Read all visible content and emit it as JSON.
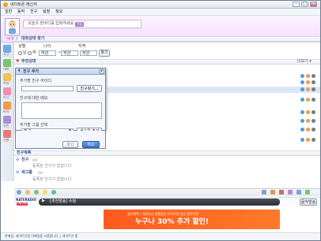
{
  "window": {
    "title": "네이트온 메신저",
    "min": "–",
    "max": "□",
    "close": "×"
  },
  "menu": [
    "일반",
    "동작",
    "친구",
    "설정",
    "정보"
  ],
  "profile": {
    "message": "오늘의 한마디를 입력하세요.",
    "edit_label": "편집",
    "avatar_caption": "내 정보"
  },
  "left_nav": [
    "친구",
    "대화",
    "쪽지",
    "미니",
    "싸이",
    "일촌",
    "선물"
  ],
  "search": {
    "header": "대화상대 찾기",
    "gender_label": "성별",
    "age_label": "나이",
    "region_label": "지역",
    "male_label": "남",
    "female_label": "여",
    "age_from": "무관",
    "age_to": "무관",
    "region_value": "무관",
    "search_button": "찾기"
  },
  "recommend": {
    "header": "추천상대",
    "more": "더보기 ▾"
  },
  "dialog": {
    "title": "친구 추가",
    "close": "×",
    "id_label": "추가할 친구 아이디",
    "find_button": "친구찾기...",
    "memo_label": "친구에 대한 메모",
    "group_label": "추가할 그룹 선택",
    "group_value": "친구",
    "add_group_button": "새그룹 추가",
    "ok_button": "확인",
    "cancel_button": "취소"
  },
  "friends": {
    "header": "친구목록",
    "groups": [
      {
        "name": "친구",
        "count": "0/0",
        "empty": "등록된 친구가 없습니다"
      },
      {
        "name": "새그룹",
        "count": "0/0",
        "empty": "등록된 친구가 없습니다"
      }
    ]
  },
  "radio": {
    "logo_top": "NATERADIO",
    "logo_bottom": "ON AIR",
    "now_playing": "[추천방송] 수정",
    "button": "음악방송"
  },
  "ad": {
    "top": "할인혜택 | 이용요금 맞춤할인 프로모션 지금 참여하면",
    "main": "누구나 30% 추가 할인!"
  },
  "status": {
    "text": "한메일, 네이트닷컴 이메일을 사용합니다. | 네이트온 홈"
  },
  "colors": {
    "accent_blue": "#2e4f8f",
    "profile_bg": "#f3dcfb",
    "ad_orange": "#ff6a24"
  }
}
